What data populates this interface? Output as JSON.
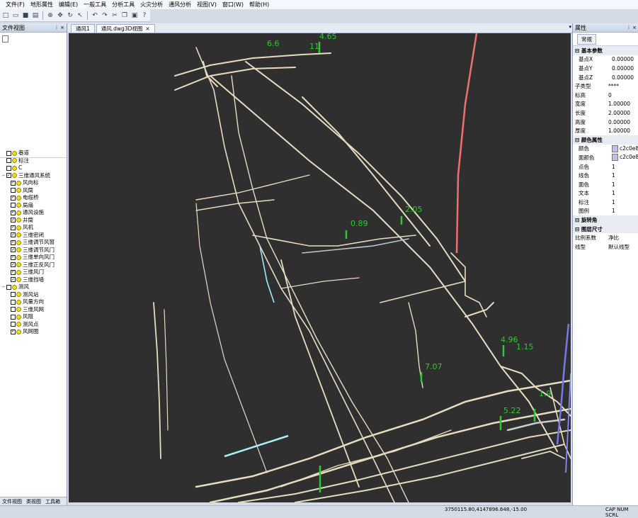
{
  "menubar": {
    "items": [
      "文件(F)",
      "地形属性",
      "编辑(E)",
      "一般工具",
      "分析工具",
      "火灾分析",
      "通风分析",
      "视图(V)",
      "窗口(W)",
      "帮助(H)"
    ]
  },
  "left_panel": {
    "title": "文件视图",
    "tree": [
      {
        "label": "巷道",
        "checked": false,
        "expand": false
      },
      {
        "label": "标注",
        "checked": false,
        "expand": false
      },
      {
        "label": "C",
        "checked": false,
        "expand": false
      },
      {
        "label": "三维通风系统",
        "checked": true,
        "expand": true
      },
      {
        "label": "风向标",
        "checked": true,
        "expand": false
      },
      {
        "label": "风筒",
        "checked": false,
        "expand": false
      },
      {
        "label": "电缆桥",
        "checked": true,
        "expand": false
      },
      {
        "label": "局扇",
        "checked": false,
        "expand": false
      },
      {
        "label": "通风设施",
        "checked": true,
        "expand": false
      },
      {
        "label": "井筒",
        "checked": true,
        "expand": false
      },
      {
        "label": "风机",
        "checked": true,
        "expand": false
      },
      {
        "label": "三维密闭",
        "checked": true,
        "expand": false
      },
      {
        "label": "三维调节风窗",
        "checked": true,
        "expand": false
      },
      {
        "label": "三维调节风门",
        "checked": true,
        "expand": false
      },
      {
        "label": "三维单向风门",
        "checked": true,
        "expand": false
      },
      {
        "label": "三维正反风门",
        "checked": true,
        "expand": false
      },
      {
        "label": "三维风门",
        "checked": true,
        "expand": false
      },
      {
        "label": "三维挡墙",
        "checked": true,
        "expand": false
      },
      {
        "label": "测风",
        "checked": false,
        "expand": true
      },
      {
        "label": "测风站",
        "checked": false,
        "expand": false
      },
      {
        "label": "风量方向",
        "checked": false,
        "expand": false
      },
      {
        "label": "三维风网",
        "checked": false,
        "expand": false
      },
      {
        "label": "风阻",
        "checked": false,
        "expand": false
      },
      {
        "label": "测风点",
        "checked": false,
        "expand": false
      },
      {
        "label": "风网图",
        "checked": true,
        "expand": false
      }
    ],
    "tabs": [
      "文件视图",
      "类视图",
      "工具箱"
    ]
  },
  "doc_tabs": [
    "通风1",
    "通风.dwg3D视图"
  ],
  "viewport": {
    "labels": [
      {
        "text": "4.65",
        "color": "#2fc82f"
      },
      {
        "text": "6.6",
        "color": "#2fc82f"
      },
      {
        "text": "11",
        "color": "#2fc82f"
      },
      {
        "text": "0.89",
        "color": "#2fc82f"
      },
      {
        "text": "2.05",
        "color": "#2fc82f"
      },
      {
        "text": "4.96",
        "color": "#2fc82f"
      },
      {
        "text": "1.15",
        "color": "#2fc82f"
      },
      {
        "text": "7.07",
        "color": "#2fc82f"
      },
      {
        "text": "1.9",
        "color": "#2fc82f"
      },
      {
        "text": "5.22",
        "color": "#2fc82f"
      }
    ]
  },
  "right_panel": {
    "title": "属性",
    "tabs": [
      "常规"
    ],
    "rows": [
      {
        "k": "基本参数",
        "v": "",
        "type": "cat"
      },
      {
        "k": "基点X",
        "v": "0.00000",
        "type": "sub"
      },
      {
        "k": "基点Y",
        "v": "0.00000",
        "type": "sub"
      },
      {
        "k": "基点Z",
        "v": "0.00000",
        "type": "sub"
      },
      {
        "k": "子类型",
        "v": "****",
        "type": ""
      },
      {
        "k": "标高",
        "v": "0",
        "type": ""
      },
      {
        "k": "宽度",
        "v": "1.00000",
        "type": ""
      },
      {
        "k": "长度",
        "v": "2.00000",
        "type": ""
      },
      {
        "k": "高度",
        "v": "0.00000",
        "type": ""
      },
      {
        "k": "厚度",
        "v": "1.00000",
        "type": ""
      },
      {
        "k": "颜色属性",
        "v": "",
        "type": "cat"
      },
      {
        "k": "颜色",
        "v": "c2c0e8",
        "type": "sub",
        "swatch": true
      },
      {
        "k": "面颜色",
        "v": "c2c0e8",
        "type": "sub",
        "swatch": true
      },
      {
        "k": "点色",
        "v": "1",
        "type": "sub"
      },
      {
        "k": "线色",
        "v": "1",
        "type": "sub"
      },
      {
        "k": "面色",
        "v": "1",
        "type": "sub"
      },
      {
        "k": "文本",
        "v": "1",
        "type": "sub"
      },
      {
        "k": "标注",
        "v": "1",
        "type": "sub"
      },
      {
        "k": "图例",
        "v": "1",
        "type": "sub"
      },
      {
        "k": "旋转角",
        "v": "",
        "type": "cat"
      },
      {
        "k": "图层尺寸",
        "v": "",
        "type": "cat"
      },
      {
        "k": "比例系数",
        "v": "净比",
        "type": ""
      },
      {
        "k": "线型",
        "v": "默认线型",
        "type": ""
      }
    ]
  },
  "statusbar": {
    "coords": "3750115.80,4147896.648,-15.00",
    "mode": "CAP NUM SCRL"
  }
}
